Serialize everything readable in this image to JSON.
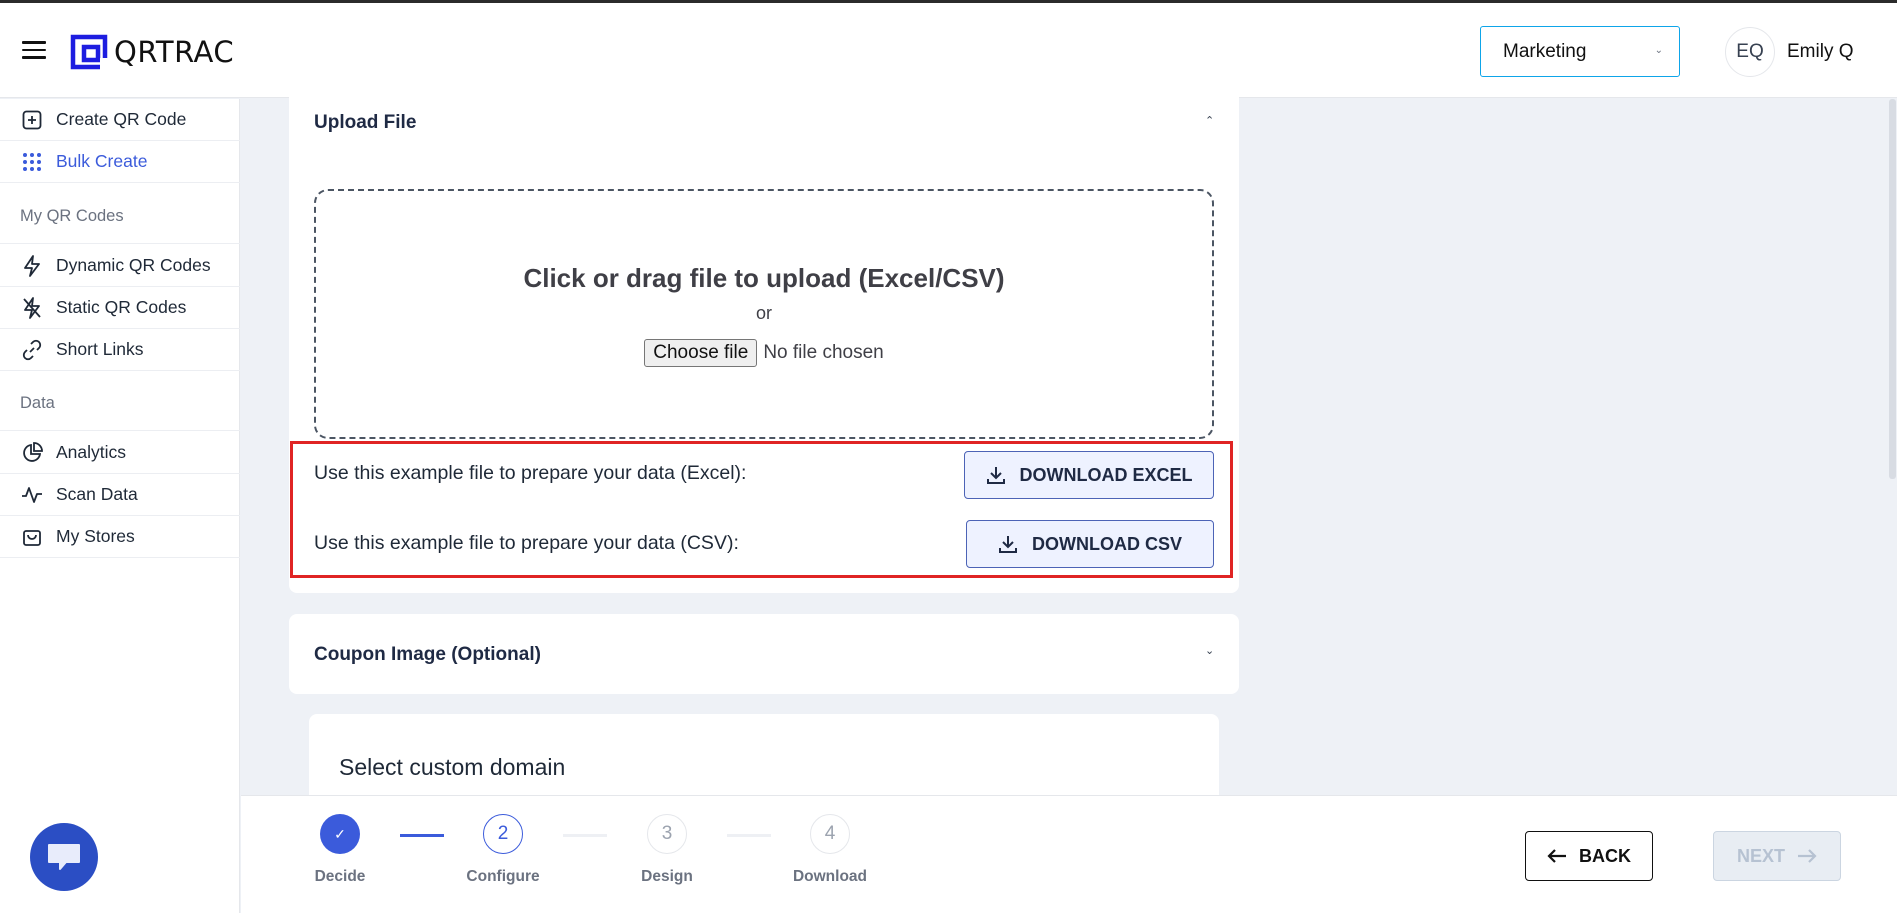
{
  "header": {
    "logo_text": "QRTRAC",
    "org_select_value": "Marketing",
    "avatar_initials": "EQ",
    "user_name": "Emily Q"
  },
  "sidebar": {
    "items_top": [
      {
        "label": "Create QR Code",
        "icon": "plus-square-icon"
      },
      {
        "label": "Bulk Create",
        "icon": "grid-dots-icon",
        "active": true
      }
    ],
    "section_qr": "My QR Codes",
    "items_qr": [
      {
        "label": "Dynamic QR Codes",
        "icon": "lightning-icon"
      },
      {
        "label": "Static QR Codes",
        "icon": "lightning-off-icon"
      },
      {
        "label": "Short Links",
        "icon": "link-icon"
      }
    ],
    "section_data": "Data",
    "items_data": [
      {
        "label": "Analytics",
        "icon": "pie-chart-icon"
      },
      {
        "label": "Scan Data",
        "icon": "activity-icon"
      },
      {
        "label": "My Stores",
        "icon": "shopping-bag-icon"
      }
    ]
  },
  "upload": {
    "title": "Upload File",
    "dropzone_title": "Click or drag file to upload (Excel/CSV)",
    "or_text": "or",
    "choose_file_label": "Choose file",
    "no_file_text": "No file chosen",
    "excel_text": "Use this example file to prepare your data (Excel):",
    "excel_button": "DOWNLOAD EXCEL",
    "csv_text": "Use this example file to prepare your data (CSV):",
    "csv_button": "DOWNLOAD CSV"
  },
  "coupon": {
    "title": "Coupon Image (Optional)"
  },
  "domain": {
    "title": "Select custom domain"
  },
  "stepper": {
    "steps": [
      {
        "number": "✓",
        "label": "Decide",
        "state": "done"
      },
      {
        "number": "2",
        "label": "Configure",
        "state": "current"
      },
      {
        "number": "3",
        "label": "Design",
        "state": "upcoming"
      },
      {
        "number": "4",
        "label": "Download",
        "state": "upcoming"
      }
    ],
    "back_label": "BACK",
    "next_label": "NEXT"
  },
  "colors": {
    "accent": "#3b5bdb",
    "highlight_border": "#e02424",
    "chat_bubble": "#2b4ec4"
  }
}
